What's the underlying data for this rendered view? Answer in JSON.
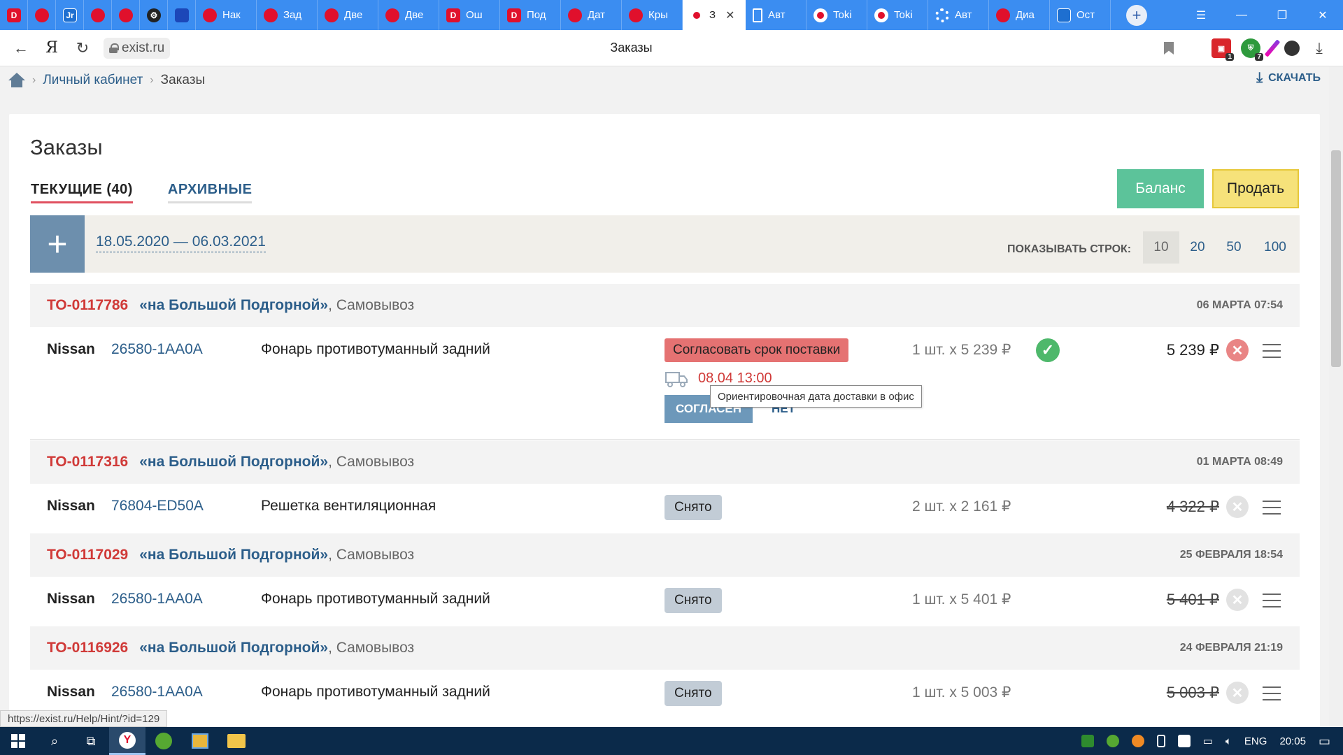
{
  "browser": {
    "tabs": [
      {
        "fav": "d",
        "label": ""
      },
      {
        "fav": "exist",
        "label": ""
      },
      {
        "fav": "jr",
        "label": ""
      },
      {
        "fav": "exist",
        "label": ""
      },
      {
        "fav": "exist",
        "label": ""
      },
      {
        "fav": "gear",
        "label": ""
      },
      {
        "fav": "blue",
        "label": ""
      },
      {
        "fav": "exist",
        "label": "Нак"
      },
      {
        "fav": "exist",
        "label": "Зад"
      },
      {
        "fav": "exist",
        "label": "Две"
      },
      {
        "fav": "exist",
        "label": "Две"
      },
      {
        "fav": "d",
        "label": "Ош"
      },
      {
        "fav": "d",
        "label": "Под"
      },
      {
        "fav": "exist",
        "label": "Дат"
      },
      {
        "fav": "exist",
        "label": "Кры"
      },
      {
        "fav": "toki",
        "label": "З",
        "active": true
      },
      {
        "fav": "doc",
        "label": "Авт"
      },
      {
        "fav": "toki",
        "label": "Toki"
      },
      {
        "fav": "toki",
        "label": "Toki"
      },
      {
        "fav": "ring",
        "label": "Авт"
      },
      {
        "fav": "exist",
        "label": "Диа"
      },
      {
        "fav": "ost",
        "label": "Ост"
      }
    ],
    "url": "exist.ru",
    "page_title": "Заказы",
    "yandex_letter": "Я",
    "ext_badges": {
      "red": "1",
      "green": "7"
    }
  },
  "breadcrumbs": {
    "items": [
      "Личный кабинет",
      "Заказы"
    ],
    "download_label": "СКАЧАТЬ"
  },
  "page": {
    "title": "Заказы",
    "tabs": {
      "current": "ТЕКУЩИЕ (40)",
      "archive": "АРХИВНЫЕ"
    },
    "balance_button": "Баланс",
    "sell_button": "Продать",
    "date_range": "18.05.2020 — 06.03.2021",
    "rows_label": "ПОКАЗЫВАТЬ СТРОК:",
    "rows_options": [
      "10",
      "20",
      "50",
      "100"
    ],
    "rows_selected": "10"
  },
  "orders": [
    {
      "id": "ТО-0117786",
      "store_open": "«",
      "store": "на Большой Подгорной",
      "store_close": "»",
      "pickup": ", Самовывоз",
      "date": "06 МАРТА 07:54",
      "brand": "Nissan",
      "part": "26580-1AA0A",
      "name": "Фонарь противотуманный задний",
      "status": "Согласовать срок поставки",
      "qty": "1 шт. x 5 239 ₽",
      "price": "5 239 ₽",
      "delivery": "08.04 13:00",
      "agree": "СОГЛАСЕН",
      "no": "НЕТ",
      "tooltip": "Ориентировочная дата доставки в офис"
    },
    {
      "id": "ТО-0117316",
      "store_open": "«",
      "store": "на Большой Подгорной",
      "store_close": "»",
      "pickup": ", Самовывоз",
      "date": "01 МАРТА 08:49",
      "brand": "Nissan",
      "part": "76804-ED50A",
      "name": "Решетка вентиляционная",
      "status": "Снято",
      "qty": "2 шт. x 2 161 ₽",
      "price": "4 322 ₽"
    },
    {
      "id": "ТО-0117029",
      "store_open": "«",
      "store": "на Большой Подгорной",
      "store_close": "»",
      "pickup": ", Самовывоз",
      "date": "25 ФЕВРАЛЯ 18:54",
      "brand": "Nissan",
      "part": "26580-1AA0A",
      "name": "Фонарь противотуманный задний",
      "status": "Снято",
      "qty": "1 шт. x 5 401 ₽",
      "price": "5 401 ₽"
    },
    {
      "id": "ТО-0116926",
      "store_open": "«",
      "store": "на Большой Подгорной",
      "store_close": "»",
      "pickup": ", Самовывоз",
      "date": "24 ФЕВРАЛЯ 21:19",
      "brand": "Nissan",
      "part": "26580-1AA0A",
      "name": "Фонарь противотуманный задний",
      "status": "Снято",
      "qty": "1 шт. x 5 003 ₽",
      "price": "5 003 ₽"
    }
  ],
  "status_url": "https://exist.ru/Help/Hint/?id=129",
  "taskbar": {
    "lang": "ENG",
    "time": "20:05"
  },
  "colors": {
    "accent_blue": "#2c5e8a",
    "order_red": "#d03a38",
    "balance_green": "#5cc39a",
    "sell_yellow": "#f6e27a"
  }
}
